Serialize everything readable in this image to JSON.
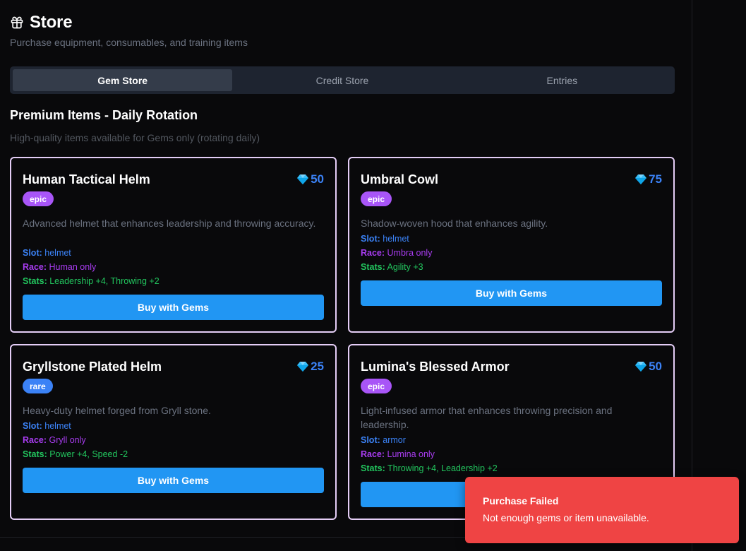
{
  "header": {
    "title": "Store",
    "subtitle": "Purchase equipment, consumables, and training items"
  },
  "tabs": [
    {
      "label": "Gem Store",
      "active": true
    },
    {
      "label": "Credit Store",
      "active": false
    },
    {
      "label": "Entries",
      "active": false
    }
  ],
  "section": {
    "title": "Premium Items - Daily Rotation",
    "subtitle": "High-quality items available for Gems only (rotating daily)"
  },
  "items": [
    {
      "name": "Human Tactical Helm",
      "price": "50",
      "rarity": "epic",
      "description": "Advanced helmet that enhances leadership and throwing accuracy.",
      "slot_label": "Slot:",
      "slot": "helmet",
      "race_label": "Race:",
      "race": "Human only",
      "stats_label": "Stats:",
      "stats": "Leadership +4, Throwing +2",
      "button": "Buy with Gems"
    },
    {
      "name": "Umbral Cowl",
      "price": "75",
      "rarity": "epic",
      "description": "Shadow-woven hood that enhances agility.",
      "slot_label": "Slot:",
      "slot": "helmet",
      "race_label": "Race:",
      "race": "Umbra only",
      "stats_label": "Stats:",
      "stats": "Agility +3",
      "button": "Buy with Gems"
    },
    {
      "name": "Gryllstone Plated Helm",
      "price": "25",
      "rarity": "rare",
      "description": "Heavy-duty helmet forged from Gryll stone.",
      "slot_label": "Slot:",
      "slot": "helmet",
      "race_label": "Race:",
      "race": "Gryll only",
      "stats_label": "Stats:",
      "stats": "Power +4, Speed -2",
      "button": "Buy with Gems"
    },
    {
      "name": "Lumina's Blessed Armor",
      "price": "50",
      "rarity": "epic",
      "description": "Light-infused armor that enhances throwing precision and leadership.",
      "slot_label": "Slot:",
      "slot": "armor",
      "race_label": "Race:",
      "race": "Lumina only",
      "stats_label": "Stats:",
      "stats": "Throwing +4, Leadership +2",
      "button": "Buy with Gems"
    }
  ],
  "toast": {
    "title": "Purchase Failed",
    "message": "Not enough gems or item unavailable."
  },
  "icons": {
    "title_icon": "gift-icon",
    "price_icon": "gem-icon"
  },
  "colors": {
    "card_border": "#e4cdf6",
    "accent_blue": "#2196f3",
    "epic_badge": "#a855f7",
    "rare_badge": "#3b82f6",
    "race_text": "#a83cf0",
    "stats_text": "#22c55e",
    "toast_bg": "#ef4444"
  }
}
